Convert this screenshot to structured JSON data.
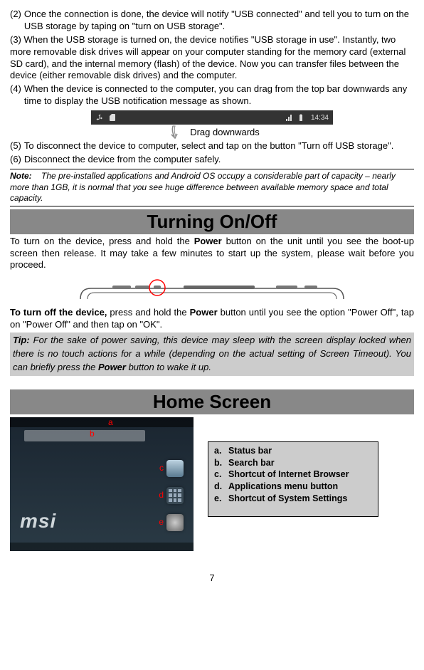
{
  "intro": {
    "item2_num": "(2)",
    "item2_text": "Once the connection is done, the device will notify \"USB connected\" and tell you to turn on the USB storage by taping on \"turn on USB storage\".",
    "item3_num": "(3)",
    "item3_text": "When the USB storage is turned on, the device notifies \"USB storage in use\". Instantly, two more removable disk drives will appear on your computer standing for the memory card (external SD card), and the internal memory (flash) of the device. Now you can transfer files between the device (either removable disk drives) and the computer.",
    "item4_num": "(4)",
    "item4_text": "When the device is connected to the computer, you can drag from the top bar downwards any time to display the USB notification message as shown.",
    "drag_label": "Drag downwards",
    "status_time": "14:34",
    "item5_num": "(5)",
    "item5_text": "To disconnect the device to computer, select and tap on the button \"Turn off USB storage\".",
    "item6_num": "(6)",
    "item6_text": "Disconnect the device from the computer safely.",
    "note_label": "Note:",
    "note_text": "The pre-installed applications and Android OS occupy a considerable part of capacity – nearly more than 1GB, it is normal that you see huge difference between available memory space and total capacity."
  },
  "turning": {
    "heading": "Turning On/Off",
    "p1_pre": "To turn on the device, press and hold the ",
    "p1_bold": "Power",
    "p1_post": " button on the unit until you see the boot-up screen then release. It may take a few minutes to start up the system, please wait before you proceed.",
    "p2_pre_bold": "To turn off the device,",
    "p2_mid": " press and hold the ",
    "p2_bold": "Power",
    "p2_post": " button until you see the option \"Power Off\", tap on \"Power Off\" and then tap on \"OK\".",
    "tip_label": "Tip:",
    "tip_mid": " For the sake of power saving, this device may sleep with the screen display locked when there is no touch actions for a while (depending on the actual setting of Screen Timeout). You can briefly press the ",
    "tip_bold": "Power",
    "tip_post": " button to wake it up."
  },
  "home": {
    "heading": "Home Screen",
    "labels": {
      "a": "a",
      "b": "b",
      "c": "c",
      "d": "d",
      "e": "e"
    },
    "logo": "msi",
    "legend": {
      "a_key": "a.",
      "a_val": "Status bar",
      "b_key": "b.",
      "b_val": "Search bar",
      "c_key": "c.",
      "c_val": "Shortcut of Internet Browser",
      "d_key": "d.",
      "d_val": "Applications menu button",
      "e_key": "e.",
      "e_val": "Shortcut of System Settings"
    }
  },
  "page_number": "7"
}
